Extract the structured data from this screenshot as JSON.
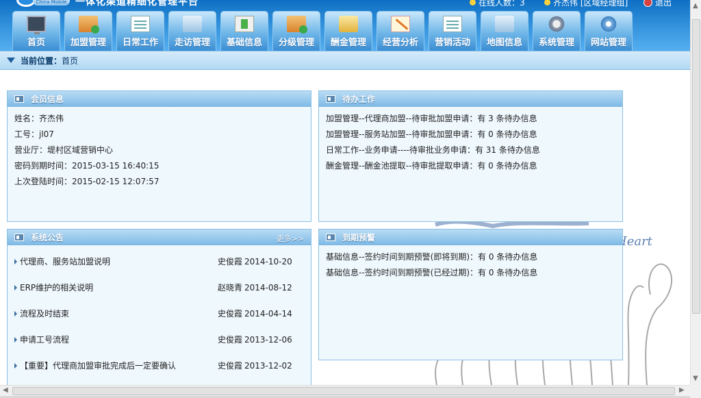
{
  "header": {
    "title_partial": "一体化渠道精细化管理平台",
    "logo_text": "China Mobile",
    "online_label": "在线人数：3",
    "user_label": "齐杰伟 [区域经理组]",
    "exit_label": "退出"
  },
  "nav": {
    "tabs": [
      {
        "label": "首页",
        "icon": "monitor-icon"
      },
      {
        "label": "加盟管理",
        "icon": "book-icon"
      },
      {
        "label": "日常工作",
        "icon": "document-icon"
      },
      {
        "label": "走访管理",
        "icon": "walk-icon"
      },
      {
        "label": "基础信息",
        "icon": "base-icon"
      },
      {
        "label": "分级管理",
        "icon": "coin-icon"
      },
      {
        "label": "酬金管理",
        "icon": "wallet-icon"
      },
      {
        "label": "经营分析",
        "icon": "pen-icon"
      },
      {
        "label": "营销活动",
        "icon": "campaign-icon"
      },
      {
        "label": "地图信息",
        "icon": "map-icon"
      },
      {
        "label": "系统管理",
        "icon": "gear-icon"
      },
      {
        "label": "网站管理",
        "icon": "globe-icon"
      }
    ]
  },
  "breadcrumb": {
    "label": "当前位置：",
    "current": "首页"
  },
  "member": {
    "title": "会员信息",
    "rows": [
      "姓名：齐杰伟",
      "工号：jl07",
      "营业厅：堤村区域营销中心",
      "密码到期时间：2015-03-15 16:40:15",
      "上次登陆时间：2015-02-15 12:07:57"
    ]
  },
  "todo": {
    "title": "待办工作",
    "rows": [
      "加盟管理--代理商加盟--待审批加盟申请：有 3 条待办信息",
      "加盟管理--服务站加盟--待审批加盟申请：有 0 条待办信息",
      "日常工作--业务申请----待审批业务申请：有 31 条待办信息",
      "酬金管理--酬金池提取--待审批提取申请：有 0 条待办信息"
    ]
  },
  "notices": {
    "title": "系统公告",
    "more": "更多>>",
    "items": [
      {
        "title": "代理商、服务站加盟说明",
        "author": "史俊霞",
        "date": "2014-10-20"
      },
      {
        "title": "ERP维护的相关说明",
        "author": "赵晓青",
        "date": "2014-08-12"
      },
      {
        "title": "流程及时结束",
        "author": "史俊霞",
        "date": "2014-04-14"
      },
      {
        "title": "申请工号流程",
        "author": "史俊霞",
        "date": "2013-12-06"
      },
      {
        "title": "【重要】代理商加盟审批完成后一定要确认",
        "author": "史俊霞",
        "date": "2013-12-02"
      }
    ]
  },
  "expiry": {
    "title": "到期预警",
    "rows": [
      "基础信息--签约时间到期预警(即将到期)：有 0 条待办信息",
      "基础信息--签约时间到期预警(已经过期)：有 0 条待办信息"
    ]
  },
  "background": {
    "art_text": "Heart"
  }
}
